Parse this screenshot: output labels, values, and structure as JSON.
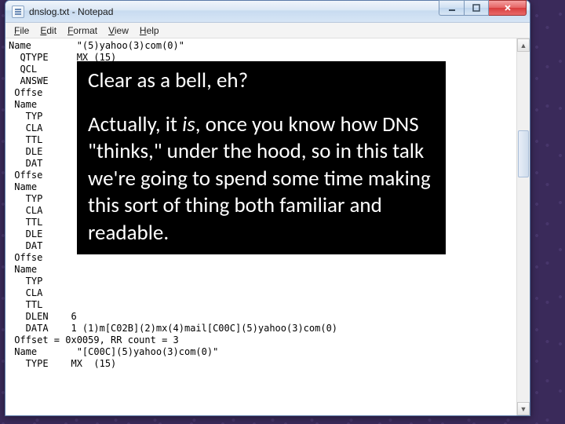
{
  "window": {
    "title": "dnslog.txt - Notepad"
  },
  "menu": {
    "file": "File",
    "edit": "Edit",
    "format": "Format",
    "view": "View",
    "help": "Help"
  },
  "content": {
    "text": "Name        \"(5)yahoo(3)com(0)\"\n  QTYPE     MX (15)\n  QCL\n  ANSWE\n Offse\n Name\n   TYP\n   CLA\n   TTL\n   DLE\n   DAT\n Offse\n Name\n   TYP\n   CLA\n   TTL\n   DLE\n   DAT\n Offse\n Name\n   TYP\n   CLA\n   TTL\n   DLEN    6\n   DATA    1 (1)m[C02B](2)mx(4)mail[C00C](5)yahoo(3)com(0)\n Offset = 0x0059, RR count = 3\n Name       \"[C00C](5)yahoo(3)com(0)\"\n   TYPE    MX  (15)"
  },
  "overlay": {
    "line1": "Clear as a bell, eh?",
    "body_pre": "Actually, it ",
    "body_em": "is",
    "body_post": ", once you know how DNS \"thinks,\" under the hood, so in this talk we're going to spend some time making this sort of thing both familiar and readable."
  },
  "scroll": {
    "up": "▲",
    "down": "▼"
  },
  "sidetext": ")"
}
